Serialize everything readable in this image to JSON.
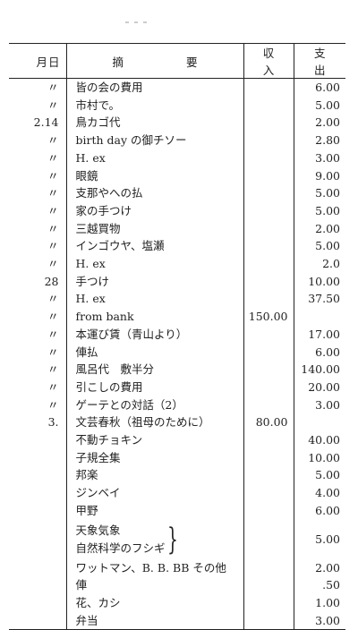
{
  "header": {
    "date": "月日",
    "desc_a": "摘",
    "desc_b": "要",
    "income": "収入",
    "expense": "支出"
  },
  "rows": [
    {
      "date": "〃",
      "desc": "皆の会の費用",
      "income": "",
      "expense": "6.00"
    },
    {
      "date": "〃",
      "desc": "市村で。",
      "income": "",
      "expense": "5.00"
    },
    {
      "date": "2.14",
      "desc": "鳥カゴ代",
      "income": "",
      "expense": "2.00"
    },
    {
      "date": "〃",
      "desc": "birth day の御チソー",
      "income": "",
      "expense": "2.80"
    },
    {
      "date": "〃",
      "desc": "H. ex",
      "income": "",
      "expense": "3.00"
    },
    {
      "date": "〃",
      "desc": "眼鏡",
      "income": "",
      "expense": "9.00"
    },
    {
      "date": "〃",
      "desc": "支那やへの払",
      "income": "",
      "expense": "5.00"
    },
    {
      "date": "〃",
      "desc": "家の手つけ",
      "income": "",
      "expense": "5.00"
    },
    {
      "date": "〃",
      "desc": "三越買物",
      "income": "",
      "expense": "2.00"
    },
    {
      "date": "〃",
      "desc": "インゴウヤ、塩瀬",
      "income": "",
      "expense": "5.00"
    },
    {
      "date": "〃",
      "desc": "H. ex",
      "income": "",
      "expense": "2.0"
    },
    {
      "date": "28",
      "desc": "手つけ",
      "income": "",
      "expense": "10.00"
    },
    {
      "date": "〃",
      "desc": "H. ex",
      "income": "",
      "expense": "37.50"
    },
    {
      "date": "〃",
      "desc": "from bank",
      "income": "150.00",
      "expense": ""
    },
    {
      "date": "〃",
      "desc": "本運び賃（青山より）",
      "income": "",
      "expense": "17.00"
    },
    {
      "date": "〃",
      "desc": "俥払",
      "income": "",
      "expense": "6.00"
    },
    {
      "date": "〃",
      "desc": "風呂代　敷半分",
      "income": "",
      "expense": "140.00"
    },
    {
      "date": "〃",
      "desc": "引こしの費用",
      "income": "",
      "expense": "20.00"
    },
    {
      "date": "〃",
      "desc": "ゲーテとの対話（2）",
      "income": "",
      "expense": "3.00"
    },
    {
      "date": "3.",
      "desc": "文芸春秋（祖母のために）",
      "income": "80.00",
      "expense": ""
    },
    {
      "date": "",
      "desc": "不動チョキン",
      "income": "",
      "expense": "40.00"
    },
    {
      "date": "",
      "desc": "子規全集",
      "income": "",
      "expense": "10.00"
    },
    {
      "date": "",
      "desc": "邦楽",
      "income": "",
      "expense": "5.00"
    },
    {
      "date": "",
      "desc": "ジンベイ",
      "income": "",
      "expense": "4.00"
    },
    {
      "date": "",
      "desc": "甲野",
      "income": "",
      "expense": "6.00"
    }
  ],
  "grouped_row": {
    "date": "",
    "line1": "天象気象",
    "line2": "自然科学のフシギ",
    "income": "",
    "expense": "5.00"
  },
  "tail_rows": [
    {
      "date": "",
      "desc": "ワットマン、B. B. BB その他",
      "income": "",
      "expense": "2.00"
    },
    {
      "date": "",
      "desc": "俥",
      "income": "",
      "expense": ".50"
    },
    {
      "date": "",
      "desc": "花、カシ",
      "income": "",
      "expense": "1.00"
    },
    {
      "date": "",
      "desc": "弁当",
      "income": "",
      "expense": "3.00"
    }
  ]
}
